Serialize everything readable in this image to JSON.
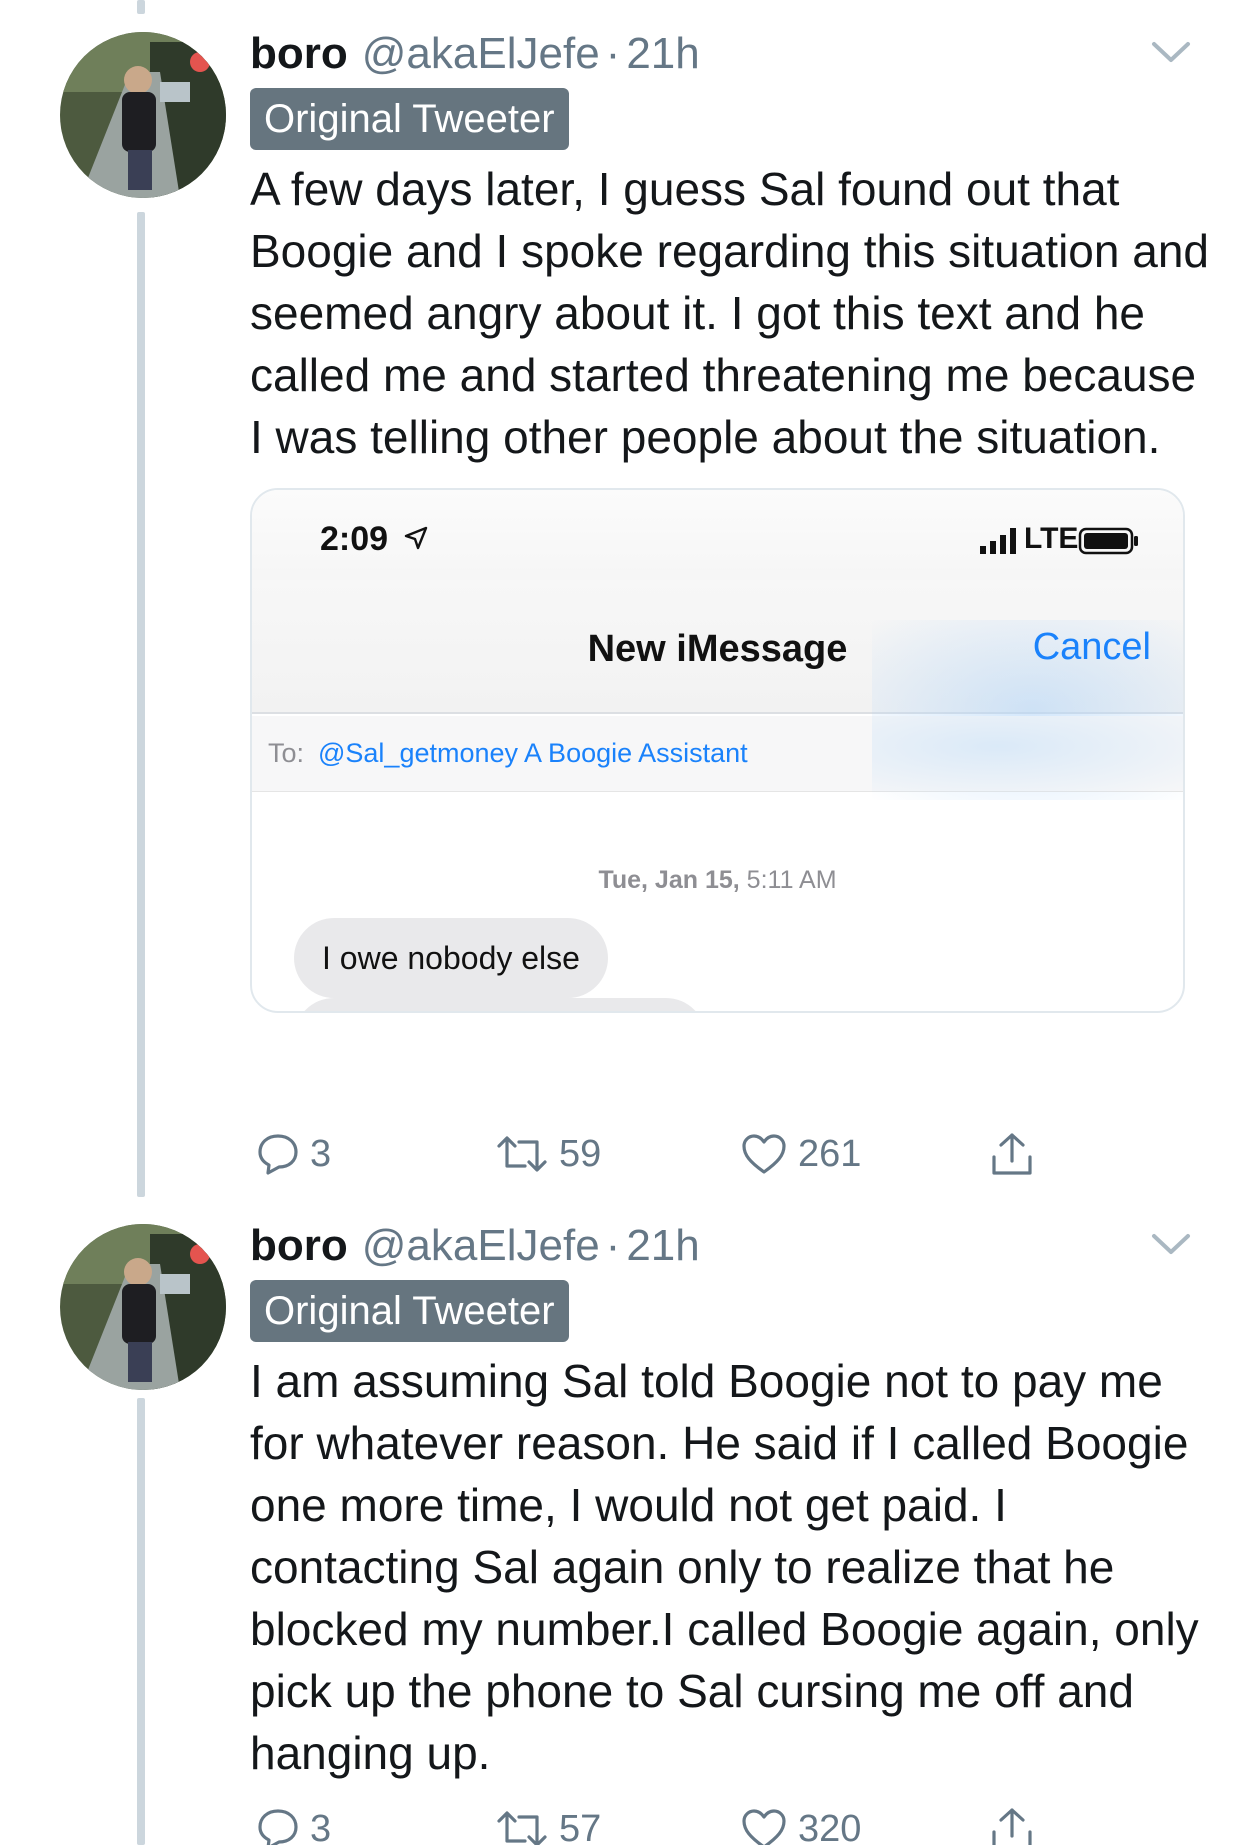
{
  "tweets": [
    {
      "name": "boro",
      "handle": "@akaElJefe",
      "separator": "·",
      "time": "21h",
      "badge": "Original Tweeter",
      "text": "A few days later, I guess Sal found out that Boogie and I spoke regarding this situation and seemed angry about it. I got this text and he called me and started threatening me because I was telling other people about the situation.",
      "media": {
        "status_time": "2:09",
        "network": "LTE",
        "title": "New iMessage",
        "cancel": "Cancel",
        "to_label": "To:",
        "recipient": "@Sal_getmoney A Boogie Assistant",
        "date_day": "Tue, Jan 15,",
        "date_time": "5:11 AM",
        "message": "I owe nobody else"
      },
      "actions": {
        "replies": "3",
        "retweets": "59",
        "likes": "261"
      }
    },
    {
      "name": "boro",
      "handle": "@akaElJefe",
      "separator": "·",
      "time": "21h",
      "badge": "Original Tweeter",
      "text": "I am assuming Sal told Boogie not to pay me for whatever reason. He said if I called Boogie one more time, I would not get paid. I contacting Sal again only to realize that he blocked my number.I called Boogie again, only pick up the phone to Sal cursing me off and hanging up.",
      "actions": {
        "replies": "3",
        "retweets": "57",
        "likes": "320"
      }
    }
  ],
  "colors": {
    "text": "#14171a",
    "secondary": "#657786",
    "badge_bg": "#66757f",
    "thread_line": "#ccd6dd",
    "ios_blue": "#1a82fb"
  },
  "icons": [
    "chevron-down-icon",
    "reply-icon",
    "retweet-icon",
    "like-icon",
    "share-icon",
    "location-arrow-icon",
    "signal-icon",
    "battery-icon"
  ]
}
